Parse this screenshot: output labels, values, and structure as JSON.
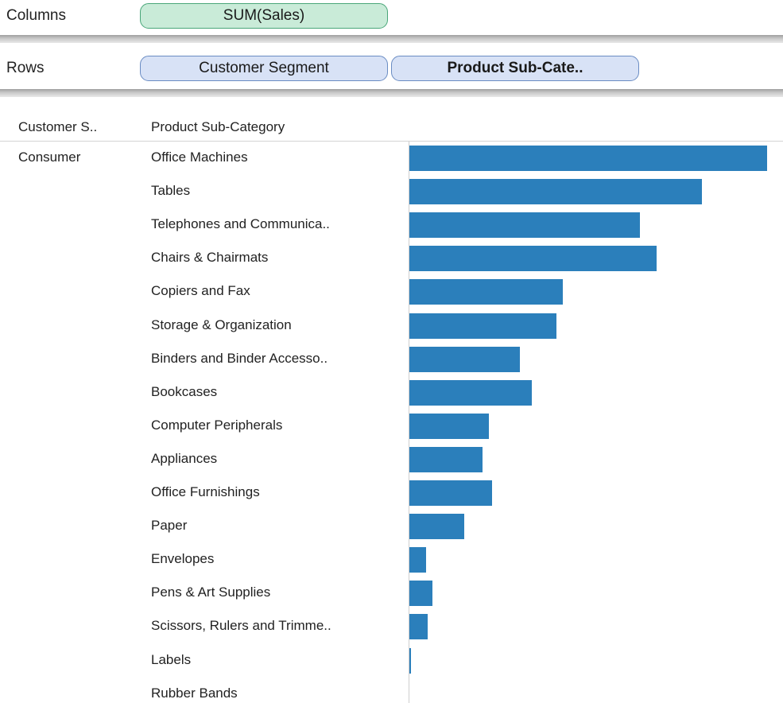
{
  "shelves": {
    "columns": {
      "label": "Columns",
      "pill": "SUM(Sales)"
    },
    "rows": {
      "label": "Rows",
      "pills": [
        "Customer Segment",
        "Product Sub-Cate.."
      ]
    }
  },
  "view": {
    "headers": [
      "Customer S..",
      "Product Sub-Category"
    ],
    "segment": "Consumer"
  },
  "colors": {
    "bar": "#2b7fbb",
    "measure_pill": "#c9ebd8",
    "dimension_pill": "#d8e2f6"
  },
  "chart_data": {
    "type": "bar",
    "orientation": "horizontal",
    "measure": "SUM(Sales)",
    "segment": "Consumer",
    "categories": [
      "Office Machines",
      "Tables",
      "Telephones and Communica..",
      "Chairs & Chairmats",
      "Copiers and Fax",
      "Storage & Organization",
      "Binders and Binder Accesso..",
      "Bookcases",
      "Computer Peripherals",
      "Appliances",
      "Office Furnishings",
      "Paper",
      "Envelopes",
      "Pens & Art Supplies",
      "Scissors, Rulers and Trimme..",
      "Labels",
      "Rubber Bands"
    ],
    "values": [
      100,
      81.8,
      64.4,
      69.1,
      42.9,
      41.1,
      30.9,
      34.2,
      22.2,
      20.4,
      23.1,
      15.3,
      4.7,
      6.4,
      5.1,
      0.4,
      0
    ],
    "value_scale": "relative (no axis printed; largest bar = 100)"
  }
}
